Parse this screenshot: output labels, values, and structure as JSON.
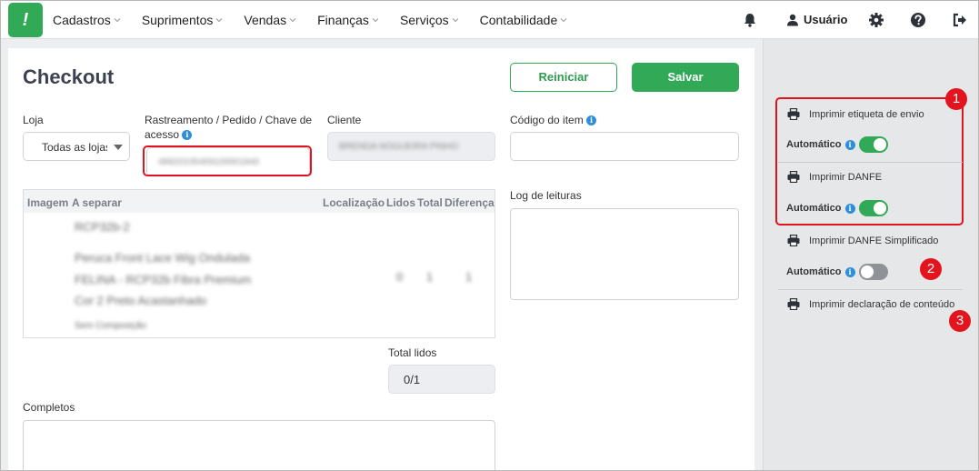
{
  "nav": {
    "logo": "!",
    "menu": [
      "Cadastros",
      "Suprimentos",
      "Vendas",
      "Finanças",
      "Serviços",
      "Contabilidade"
    ],
    "user_label": "Usuário",
    "icons": [
      "bell-icon",
      "user-icon",
      "gear-icon",
      "help-icon",
      "logout-icon"
    ]
  },
  "page": {
    "title": "Checkout",
    "reset_label": "Reiniciar",
    "save_label": "Salvar"
  },
  "form": {
    "loja_label": "Loja",
    "loja_value": "Todas as lojas",
    "rastreamento_label_1": "Rastreamento / Pedido / Chave de",
    "rastreamento_label_2": "acesso",
    "rastreamento_value": "48920105469100001840",
    "cliente_label": "Cliente",
    "cliente_value": "BRENDA NOGUEIRA PINHO",
    "codigo_label": "Código do item",
    "log_label": "Log de leituras",
    "total_lidos_label": "Total lidos",
    "total_lidos_value": "0/1",
    "completos_label": "Completos"
  },
  "table": {
    "headers": [
      "Imagem",
      "A separar",
      "Localização",
      "Lidos",
      "Total",
      "Diferença"
    ],
    "rows": [
      {
        "line1": "RCP32b-2",
        "line2": "Peruca Front Lace Wig Ondulada",
        "line3": "FELINA - RCP32b Fibra Premium",
        "line4": "Cor 2 Preto Acastanhado",
        "line5": "Sem Composição",
        "localizacao": "",
        "lidos": "0",
        "total": "1",
        "diferenca": "1"
      }
    ]
  },
  "sidepanel": {
    "items": [
      {
        "label": "Imprimir etiqueta de envio",
        "auto_label": "Automático",
        "auto_on": true
      },
      {
        "label": "Imprimir DANFE",
        "auto_label": "Automático",
        "auto_on": true
      },
      {
        "label": "Imprimir DANFE Simplificado",
        "auto_label": "Automático",
        "auto_on": false
      },
      {
        "label": "Imprimir declaração de conteúdo"
      }
    ],
    "badges": [
      "1",
      "2",
      "3"
    ]
  },
  "colors": {
    "brand_green": "#32a957",
    "annotation_red": "#e3141d",
    "info_blue": "#2f8fd6"
  }
}
